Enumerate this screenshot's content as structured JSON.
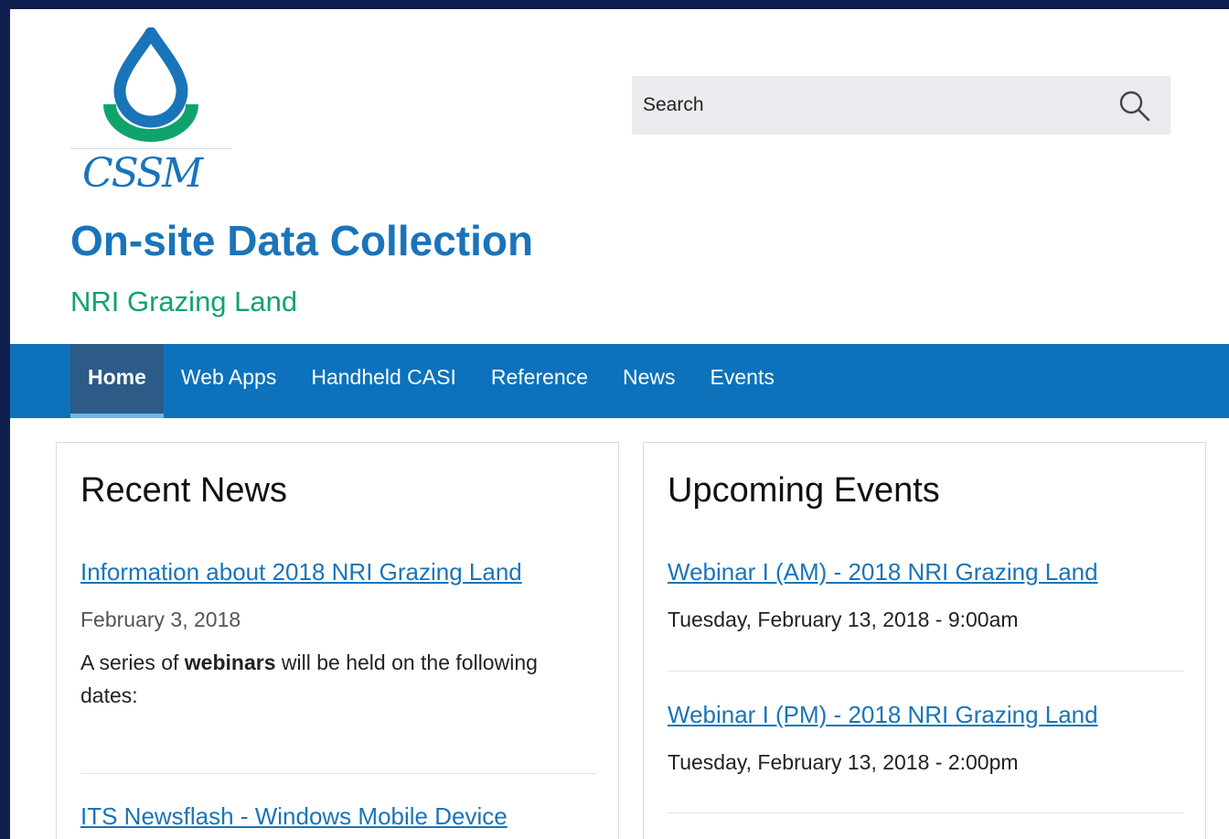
{
  "brand": {
    "logo_text": "CSSM"
  },
  "site": {
    "title": "On-site Data Collection",
    "slogan": "NRI Grazing Land"
  },
  "search": {
    "placeholder": "Search"
  },
  "nav": {
    "items": [
      {
        "label": "Home",
        "active": true
      },
      {
        "label": "Web Apps",
        "active": false
      },
      {
        "label": "Handheld CASI",
        "active": false
      },
      {
        "label": "Reference",
        "active": false
      },
      {
        "label": "News",
        "active": false
      },
      {
        "label": "Events",
        "active": false
      }
    ]
  },
  "news": {
    "heading": "Recent News",
    "items": [
      {
        "title": "Information about 2018 NRI Grazing Land",
        "date": "February 3, 2018",
        "body_prefix": "A series of ",
        "body_bold": "webinars",
        "body_suffix": " will be held on the following dates:"
      },
      {
        "title": "ITS Newsflash - Windows Mobile Device"
      }
    ]
  },
  "events": {
    "heading": "Upcoming Events",
    "items": [
      {
        "title": "Webinar I (AM) - 2018 NRI Grazing Land",
        "date": "Tuesday, February 13, 2018 - 9:00am"
      },
      {
        "title": "Webinar I (PM) - 2018 NRI Grazing Land",
        "date": "Tuesday, February 13, 2018 - 2:00pm"
      }
    ]
  },
  "colors": {
    "brand_blue": "#1a74b9",
    "brand_green": "#0fa36b",
    "nav_background": "#0d72bb",
    "nav_active": "#2b5b86",
    "outer_background": "#0f1f4e"
  }
}
